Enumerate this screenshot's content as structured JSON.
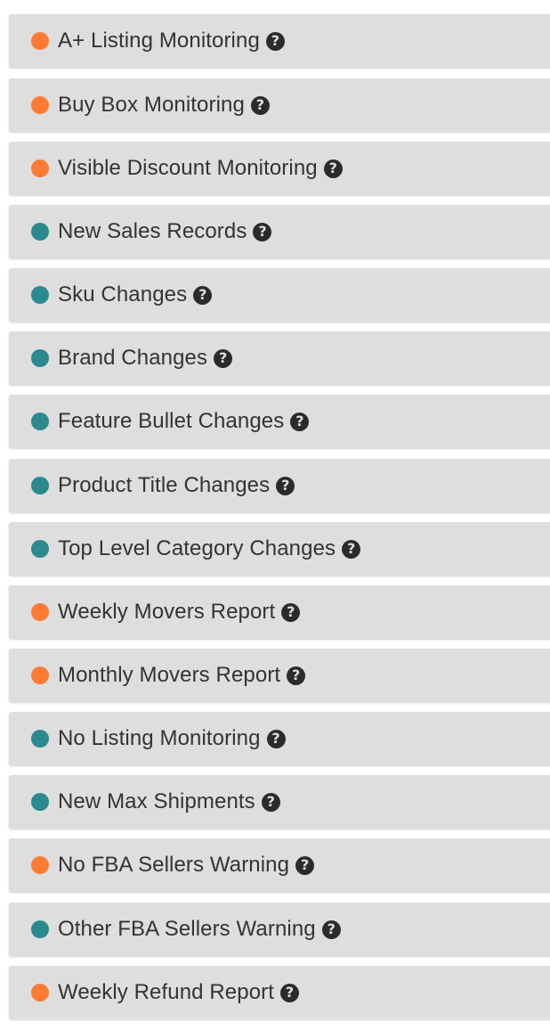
{
  "help_glyph": "?",
  "status_colors": {
    "orange": "#ff7a33",
    "teal": "#2a8a8e"
  },
  "items": [
    {
      "label": "A+ Listing Monitoring",
      "status": "orange",
      "icon": "question-circle-icon"
    },
    {
      "label": "Buy Box Monitoring",
      "status": "orange",
      "icon": "question-circle-icon"
    },
    {
      "label": "Visible Discount Monitoring",
      "status": "orange",
      "icon": "question-circle-icon"
    },
    {
      "label": "New Sales Records",
      "status": "teal",
      "icon": "question-circle-icon"
    },
    {
      "label": "Sku Changes",
      "status": "teal",
      "icon": "question-circle-icon"
    },
    {
      "label": "Brand Changes",
      "status": "teal",
      "icon": "question-circle-icon"
    },
    {
      "label": "Feature Bullet Changes",
      "status": "teal",
      "icon": "question-circle-icon"
    },
    {
      "label": "Product Title Changes",
      "status": "teal",
      "icon": "question-circle-icon"
    },
    {
      "label": "Top Level Category Changes",
      "status": "teal",
      "icon": "question-circle-icon"
    },
    {
      "label": "Weekly Movers Report",
      "status": "orange",
      "icon": "question-circle-icon"
    },
    {
      "label": "Monthly Movers Report",
      "status": "orange",
      "icon": "question-circle-icon"
    },
    {
      "label": "No Listing Monitoring",
      "status": "teal",
      "icon": "question-circle-icon"
    },
    {
      "label": "New Max Shipments",
      "status": "teal",
      "icon": "question-circle-icon"
    },
    {
      "label": "No FBA Sellers Warning",
      "status": "orange",
      "icon": "question-circle-icon"
    },
    {
      "label": "Other FBA Sellers Warning",
      "status": "teal",
      "icon": "question-circle-icon"
    },
    {
      "label": "Weekly Refund Report",
      "status": "orange",
      "icon": "question-circle-icon"
    }
  ]
}
